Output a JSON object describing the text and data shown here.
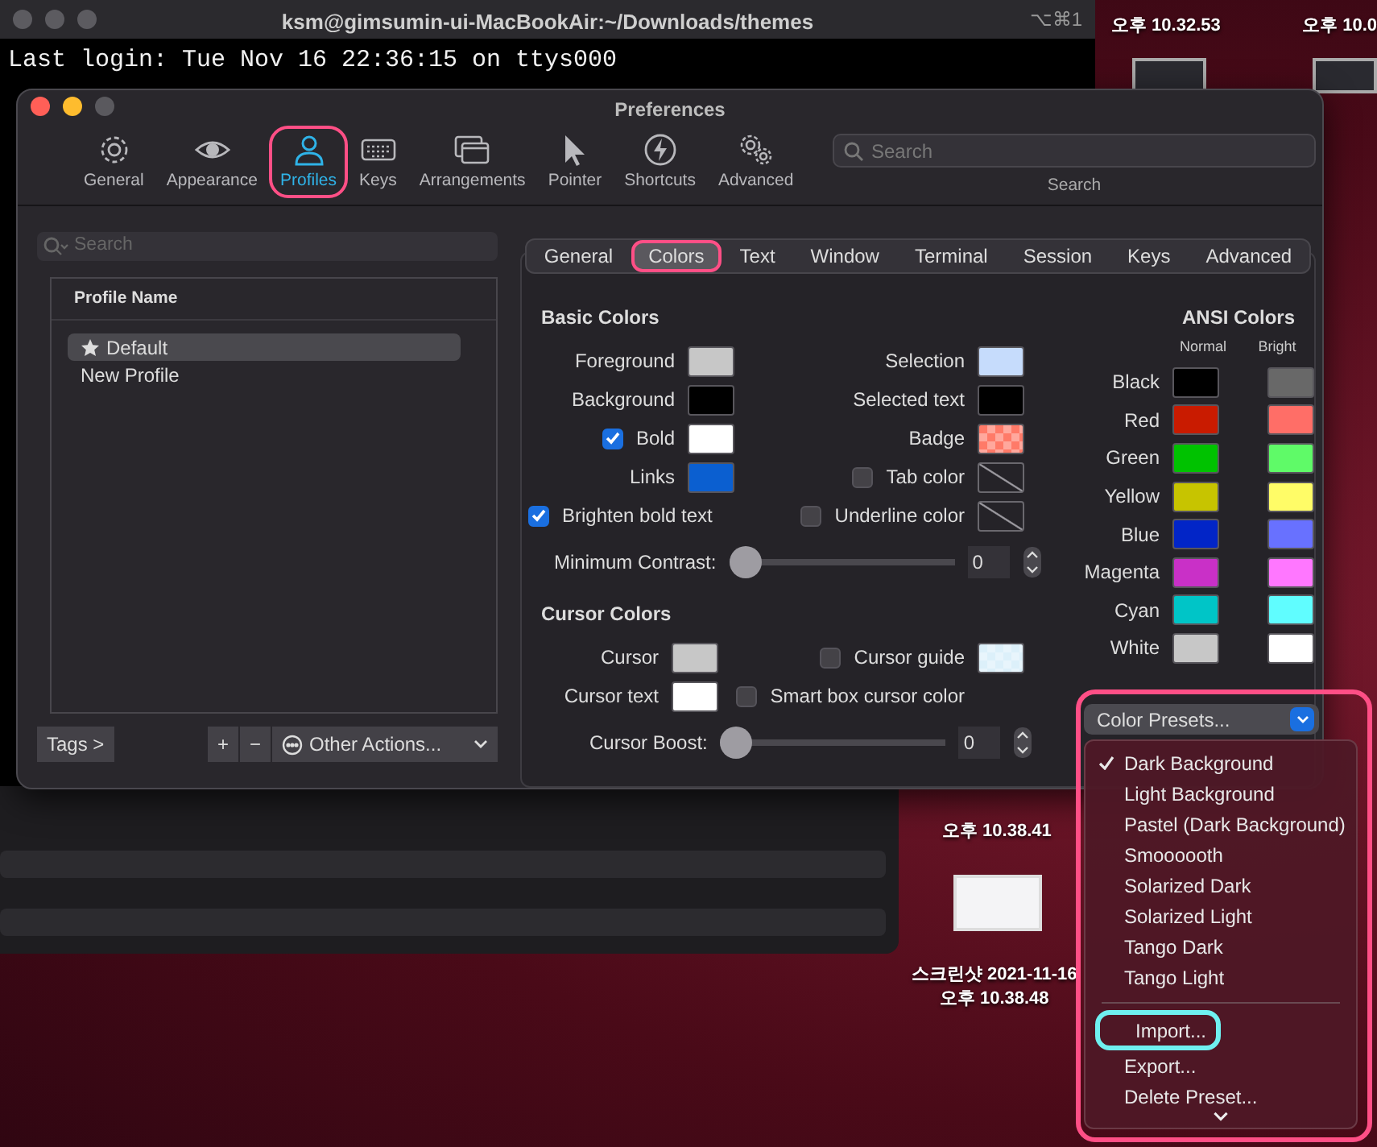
{
  "desktop_labels": [
    {
      "lines": [
        "오후 10.32.53"
      ]
    },
    {
      "lines": [
        "오후 10.0"
      ]
    },
    {
      "lines": [
        "오후 10.38.41"
      ]
    },
    {
      "lines": [
        "스크린샷 2021-11-16",
        "오후 10.38.48"
      ]
    }
  ],
  "terminal": {
    "title": "ksm@gimsumin-ui-MacBookAir:~/Downloads/themes",
    "shortcut": "⌥⌘1",
    "lines": [
      "Last login: Tue Nov 16 22:36:15 on ttys000"
    ]
  },
  "preferences": {
    "title": "Preferences",
    "toolbar": [
      {
        "label": "General",
        "selected": false,
        "circled": false
      },
      {
        "label": "Appearance",
        "selected": false,
        "circled": false
      },
      {
        "label": "Profiles",
        "selected": true,
        "circled": true
      },
      {
        "label": "Keys",
        "selected": false,
        "circled": false
      },
      {
        "label": "Arrangements",
        "selected": false,
        "circled": false
      },
      {
        "label": "Pointer",
        "selected": false,
        "circled": false
      },
      {
        "label": "Shortcuts",
        "selected": false,
        "circled": false
      },
      {
        "label": "Advanced",
        "selected": false,
        "circled": false
      }
    ],
    "search": {
      "placeholder": "Search",
      "caption": "Search"
    },
    "profiles": {
      "search_placeholder": "Search",
      "column": "Profile Name",
      "rows": [
        {
          "name": "Default",
          "default": true,
          "selected": true
        },
        {
          "name": "New Profile",
          "default": false,
          "selected": false
        }
      ],
      "tags_button": "Tags >",
      "add_button": "+",
      "remove_button": "−",
      "other_actions": "Other Actions..."
    },
    "tabs": [
      {
        "label": "General",
        "selected": false,
        "circled": false
      },
      {
        "label": "Colors",
        "selected": true,
        "circled": true
      },
      {
        "label": "Text",
        "selected": false,
        "circled": false
      },
      {
        "label": "Window",
        "selected": false,
        "circled": false
      },
      {
        "label": "Terminal",
        "selected": false,
        "circled": false
      },
      {
        "label": "Session",
        "selected": false,
        "circled": false
      },
      {
        "label": "Keys",
        "selected": false,
        "circled": false
      },
      {
        "label": "Advanced",
        "selected": false,
        "circled": false
      }
    ],
    "basic_colors": {
      "title": "Basic Colors",
      "left": [
        {
          "kind": "swatch",
          "label": "Foreground",
          "swatch": {
            "kind": "solid",
            "color": "#c7c7c7"
          }
        },
        {
          "kind": "swatch",
          "label": "Background",
          "swatch": {
            "kind": "solid",
            "color": "#000000"
          }
        },
        {
          "kind": "check-swatch",
          "label": "Bold",
          "checked": true,
          "swatch": {
            "kind": "solid",
            "color": "#ffffff"
          }
        },
        {
          "kind": "swatch",
          "label": "Links",
          "swatch": {
            "kind": "solid",
            "color": "#0b5fd0"
          }
        },
        {
          "kind": "check",
          "label": "Brighten bold text",
          "checked": true
        }
      ],
      "right": [
        {
          "kind": "swatch",
          "label": "Selection",
          "swatch": {
            "kind": "solid",
            "color": "#c6dcfc"
          }
        },
        {
          "kind": "swatch",
          "label": "Selected text",
          "swatch": {
            "kind": "solid",
            "color": "#000000"
          }
        },
        {
          "kind": "swatch",
          "label": "Badge",
          "swatch": {
            "kind": "checker",
            "color": "#ff7a68"
          }
        },
        {
          "kind": "check-swatch",
          "label": "Tab color",
          "checked": false,
          "swatch": {
            "kind": "none"
          }
        },
        {
          "kind": "check-swatch",
          "label": "Underline color",
          "checked": false,
          "swatch": {
            "kind": "none"
          }
        }
      ],
      "slider": {
        "label": "Minimum Contrast:",
        "level": 0,
        "value": "0"
      }
    },
    "cursor_colors": {
      "title": "Cursor Colors",
      "left": [
        {
          "kind": "swatch",
          "label": "Cursor",
          "swatch": {
            "kind": "solid",
            "color": "#c7c7c7"
          }
        },
        {
          "kind": "swatch",
          "label": "Cursor text",
          "swatch": {
            "kind": "solid",
            "color": "#ffffff"
          }
        }
      ],
      "right": [
        {
          "kind": "check-swatch",
          "label": "Cursor guide",
          "checked": false,
          "swatch": {
            "kind": "checker",
            "color": "#dcf0fa"
          }
        },
        {
          "kind": "check",
          "label": "Smart box cursor color",
          "checked": false
        }
      ],
      "slider": {
        "label": "Cursor Boost:",
        "level": 0,
        "value": "0"
      }
    },
    "ansi_colors": {
      "title": "ANSI Colors",
      "columns": [
        "Normal",
        "Bright"
      ],
      "rows": [
        {
          "label": "Black",
          "swatches": [
            {
              "color": "#000000"
            },
            {
              "color": "#686868"
            }
          ]
        },
        {
          "label": "Red",
          "swatches": [
            {
              "color": "#c91b00"
            },
            {
              "color": "#ff6e67"
            }
          ]
        },
        {
          "label": "Green",
          "swatches": [
            {
              "color": "#00c200"
            },
            {
              "color": "#5ffa68"
            }
          ]
        },
        {
          "label": "Yellow",
          "swatches": [
            {
              "color": "#c7c400"
            },
            {
              "color": "#fffc67"
            }
          ]
        },
        {
          "label": "Blue",
          "swatches": [
            {
              "color": "#0225c7"
            },
            {
              "color": "#6871ff"
            }
          ]
        },
        {
          "label": "Magenta",
          "swatches": [
            {
              "color": "#c930c7"
            },
            {
              "color": "#ff77ff"
            }
          ]
        },
        {
          "label": "Cyan",
          "swatches": [
            {
              "color": "#00c5c7"
            },
            {
              "color": "#60fdff"
            }
          ]
        },
        {
          "label": "White",
          "swatches": [
            {
              "color": "#c7c7c7"
            },
            {
              "color": "#ffffff"
            }
          ]
        }
      ]
    }
  },
  "color_presets": {
    "button": "Color Presets...",
    "circled": true,
    "items": [
      {
        "kind": "item",
        "label": "Dark Background",
        "checked": true,
        "circled": false
      },
      {
        "kind": "item",
        "label": "Light Background",
        "checked": false,
        "circled": false
      },
      {
        "kind": "item",
        "label": "Pastel (Dark Background)",
        "checked": false,
        "circled": false
      },
      {
        "kind": "item",
        "label": "Smoooooth",
        "checked": false,
        "circled": false
      },
      {
        "kind": "item",
        "label": "Solarized Dark",
        "checked": false,
        "circled": false
      },
      {
        "kind": "item",
        "label": "Solarized Light",
        "checked": false,
        "circled": false
      },
      {
        "kind": "item",
        "label": "Tango Dark",
        "checked": false,
        "circled": false
      },
      {
        "kind": "item",
        "label": "Tango Light",
        "checked": false,
        "circled": false
      },
      {
        "kind": "separator"
      },
      {
        "kind": "item",
        "label": "Import...",
        "checked": false,
        "circled": true
      },
      {
        "kind": "item",
        "label": "Export...",
        "checked": false,
        "circled": false
      },
      {
        "kind": "item",
        "label": "Delete Preset...",
        "checked": false,
        "circled": false
      }
    ]
  }
}
